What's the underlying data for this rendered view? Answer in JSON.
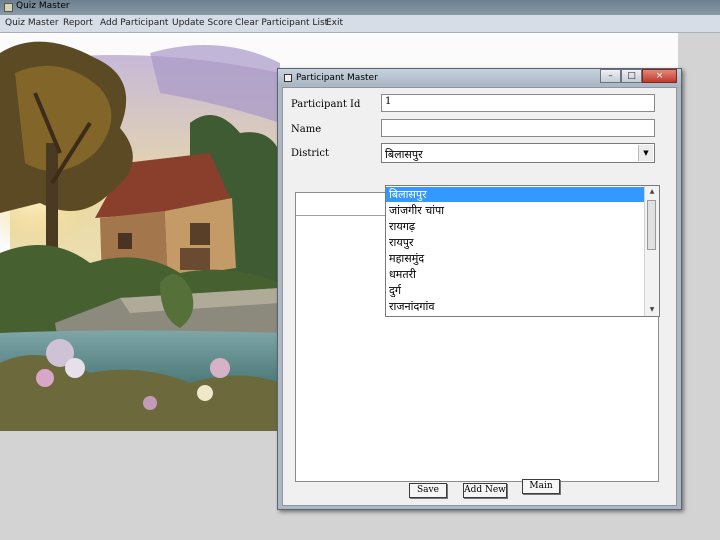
{
  "window": {
    "title": "Quiz Master"
  },
  "menu": [
    "Quiz Master",
    "Report",
    "Add Participant",
    "Update Score",
    "Clear Participant List",
    "Exit"
  ],
  "dialog": {
    "title": "Participant Master",
    "controls": {
      "minimize": "–",
      "maximize": "□",
      "close": "×"
    },
    "fields": {
      "participant_id": {
        "label": "Participant Id",
        "value": "1"
      },
      "name": {
        "label": "Name",
        "value": ""
      },
      "district": {
        "label": "District",
        "value": "बिलासपुर"
      }
    },
    "district_options": [
      "बिलासपुर",
      "जांजगीर चांपा",
      "रायगढ़",
      "रायपुर",
      "महासमुंद",
      "धमतरी",
      "दुर्ग",
      "राजनांदगांव"
    ],
    "buttons": {
      "save": "Save",
      "add_new": "Add New",
      "main": "Main"
    }
  },
  "icons": [
    "app-icon",
    "dialog-icon",
    "dropdown-arrow-icon",
    "scroll-up-icon",
    "scroll-down-icon"
  ]
}
